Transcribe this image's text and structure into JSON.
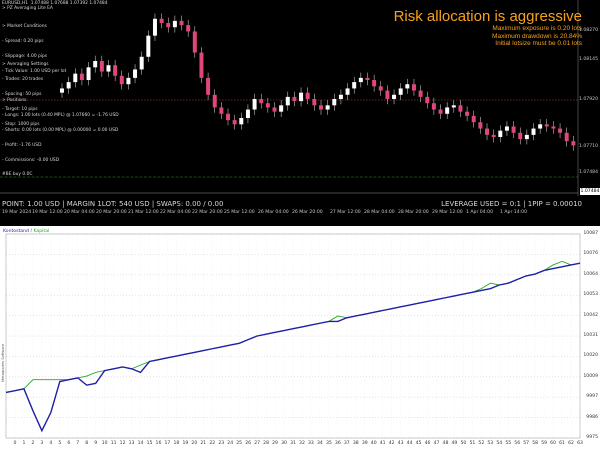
{
  "chart_header": {
    "symbol_line": "EURUSD,H1  1.07488 1.07688 1.07392 1.07484",
    "ea_name": "> PZ Averaging Lite EA"
  },
  "market_conditions": [
    "> Market Conditions",
    "- Spread: 0.20 pips",
    "- Slippage: 4.00 pips",
    "- Tick Value: 1.00 USD per lot"
  ],
  "averaging_settings": [
    "> Averaging Settings",
    "- Trades: 20 trades",
    "- Spacing: 50 pips",
    "- Target: 10 pips",
    "- Stop: 1000 pips"
  ],
  "positions": [
    "> Positions",
    "- Longs: 1.00 lots (0.40 MPL) @ 1.07660 = -1.76 USD",
    "- Shorts: 0.00 lots (0.00 MPL) @ 0.00000 = 0.00 USD",
    "- Profit: -1.76 USD",
    "- Commissions: -0.00 USD"
  ],
  "risk": {
    "title": "Risk allocation is aggressive",
    "lines": [
      "Maximum exposure is 0.20 lots",
      "Maximum drawdown is 20.84%",
      "Initial lotsize must be 0.01 lots"
    ]
  },
  "breakeven_label": "#BE buy 0.0C",
  "price_axis": [
    "1.08270",
    "1.08145",
    "1.07920",
    "1.07710",
    "1.07484"
  ],
  "current_price": "1.07484",
  "status_bar": {
    "left": "POINT: 1.00 USD | MARGIN 1LOT: 540 USD | SWAPS: 0.00 / 0.00",
    "right": "LEVERAGE USED = 0:1 | 1PIP = 0.00010"
  },
  "time_axis": [
    "19 Mar 2024",
    "19 Mar 12:00",
    "20 Mar 04:00",
    "20 Mar 20:00",
    "21 Mar 12:00",
    "22 Mar 04:00",
    "22 Mar 20:00",
    "25 Mar 12:00",
    "26 Mar 04:00",
    "26 Mar 20:00",
    "27 Mar 12:00",
    "28 Mar 04:00",
    "28 Mar 20:00",
    "29 Mar 12:00",
    "1 Apr 04:00",
    "1 Apr 14:00"
  ],
  "equity_legend": {
    "balance": "Kontostand",
    "separator": "/",
    "equity": "Kapital"
  },
  "watermark": "Metaquotes Software",
  "chart_data": {
    "type": "line",
    "x": [
      0,
      1,
      2,
      3,
      4,
      5,
      6,
      7,
      8,
      9,
      10,
      11,
      12,
      13,
      14,
      15,
      16,
      17,
      18,
      19,
      20,
      21,
      22,
      23,
      24,
      25,
      26,
      27,
      28,
      29,
      30,
      31,
      32,
      33,
      34,
      35,
      36,
      37,
      38,
      39,
      40,
      41,
      42,
      43,
      44,
      45,
      46,
      47,
      48,
      49,
      50,
      51,
      52,
      53,
      54,
      55,
      56,
      57,
      58,
      59,
      60,
      61,
      62,
      63,
      64
    ],
    "x_tick_labels": [
      "0",
      "1",
      "2",
      "3",
      "4",
      "5",
      "6",
      "7",
      "8",
      "9",
      "10",
      "11",
      "12",
      "13",
      "14",
      "15",
      "16",
      "17",
      "18",
      "19",
      "20",
      "21",
      "22",
      "23",
      "24",
      "25",
      "26",
      "27",
      "28",
      "29",
      "30",
      "31",
      "32",
      "33",
      "34",
      "35",
      "36",
      "37",
      "38",
      "39",
      "40",
      "41",
      "42",
      "43",
      "44",
      "45",
      "46",
      "47",
      "48",
      "49",
      "50",
      "51",
      "52",
      "53",
      "54",
      "55",
      "56",
      "57",
      "58",
      "59",
      "60",
      "61",
      "62",
      "63"
    ],
    "y_tick_labels": [
      "10087",
      "10076",
      "10064",
      "10053",
      "10042",
      "10031",
      "10020",
      "10009",
      "9997",
      "9986",
      "9975"
    ],
    "ylim": [
      9975,
      10087
    ],
    "series": [
      {
        "name": "Kontostand",
        "color": "#1f1fa8",
        "values": [
          10000,
          10001,
          10002,
          9990,
          9979,
          9989,
          10006,
          10007,
          10008,
          10004,
          10005,
          10012,
          10013,
          10014,
          10013,
          10011,
          10017,
          10018,
          10019,
          10020,
          10021,
          10022,
          10023,
          10024,
          10025,
          10026,
          10027,
          10029,
          10031,
          10032,
          10033,
          10034,
          10035,
          10036,
          10037,
          10038,
          10039,
          10039,
          10041,
          10042,
          10043,
          10044,
          10045,
          10046,
          10047,
          10048,
          10049,
          10050,
          10051,
          10052,
          10053,
          10054,
          10055,
          10056,
          10057,
          10059,
          10060,
          10062,
          10064,
          10065,
          10067,
          10068,
          10069,
          10070,
          10071
        ]
      },
      {
        "name": "Kapital",
        "color": "#22aa22",
        "values": [
          10000,
          10001,
          10002,
          10007,
          10007,
          10007,
          10007,
          10007,
          10008,
          10009,
          10011,
          10012,
          10013,
          10014,
          10013,
          10015,
          10017,
          10018,
          10019,
          10020,
          10021,
          10022,
          10023,
          10024,
          10025,
          10026,
          10027,
          10029,
          10031,
          10032,
          10033,
          10034,
          10035,
          10036,
          10037,
          10038,
          10039,
          10042,
          10041,
          10042,
          10043,
          10044,
          10045,
          10046,
          10047,
          10048,
          10049,
          10050,
          10051,
          10052,
          10053,
          10054,
          10055,
          10057,
          10060,
          10059,
          10060,
          10062,
          10064,
          10065,
          10067,
          10070,
          10072,
          10070,
          10071
        ]
      }
    ]
  },
  "price_chart": {
    "type": "candlestick",
    "ylim": [
      1.0745,
      1.0835
    ],
    "close": [
      1.0795,
      1.0798,
      1.0802,
      1.0799,
      1.0805,
      1.0808,
      1.0803,
      1.0806,
      1.0801,
      1.0797,
      1.08,
      1.0804,
      1.081,
      1.082,
      1.0828,
      1.0826,
      1.0824,
      1.0827,
      1.0825,
      1.0822,
      1.0812,
      1.08,
      1.0792,
      1.0786,
      1.0783,
      1.078,
      1.0778,
      1.0781,
      1.0785,
      1.079,
      1.0788,
      1.0786,
      1.0784,
      1.0787,
      1.0791,
      1.0789,
      1.0793,
      1.079,
      1.0787,
      1.0785,
      1.0787,
      1.079,
      1.0792,
      1.0795,
      1.0798,
      1.08,
      1.0799,
      1.0796,
      1.0794,
      1.079,
      1.0792,
      1.0795,
      1.0797,
      1.0794,
      1.0791,
      1.0788,
      1.0785,
      1.0783,
      1.0786,
      1.0787,
      1.0784,
      1.0782,
      1.0779,
      1.0776,
      1.0773,
      1.0772,
      1.0775,
      1.0777,
      1.0774,
      1.0771,
      1.0773,
      1.0776,
      1.0778,
      1.0777,
      1.0776,
      1.0774,
      1.077,
      1.0768
    ]
  }
}
